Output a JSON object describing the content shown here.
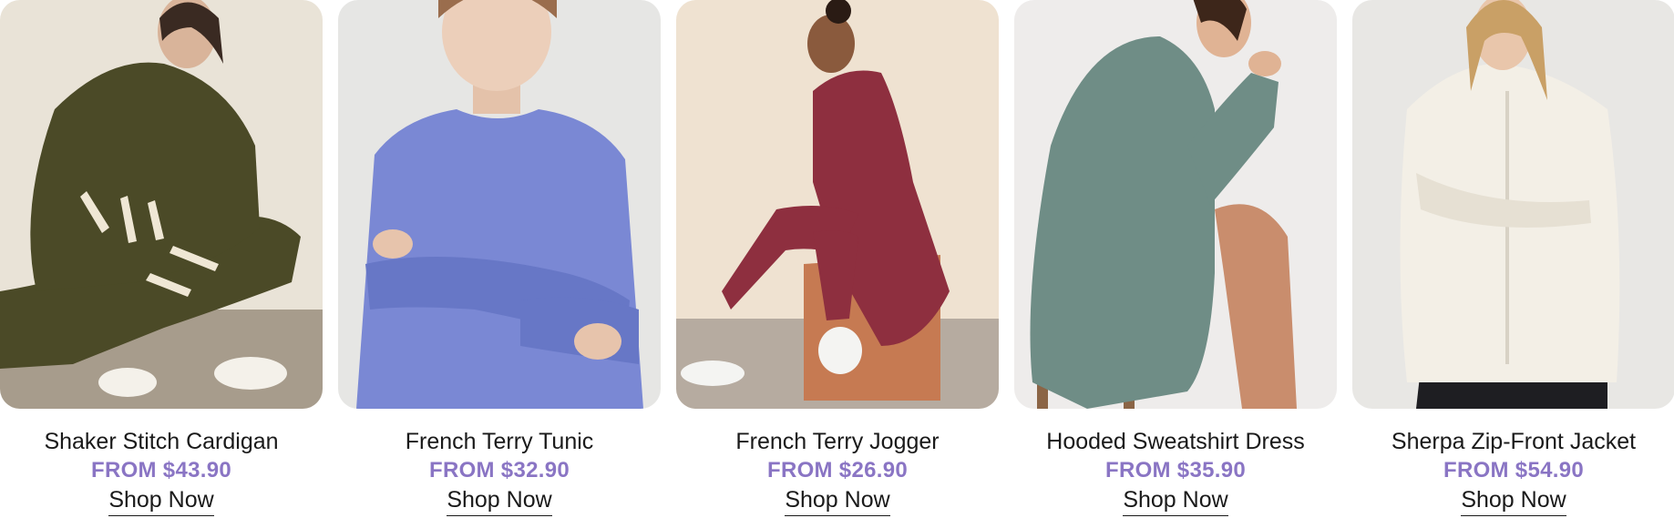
{
  "accent_color": "#8a75c4",
  "products": [
    {
      "name": "Shaker Stitch Cardigan",
      "price": "FROM $43.90",
      "cta": "Shop Now",
      "image_icon": "product-photo-olive-cardigan",
      "colors": {
        "bg": "#e9e3d7",
        "floor": "#a79c8c",
        "garment": "#4b4a27",
        "accent": "#efe7d5"
      }
    },
    {
      "name": "French Terry Tunic",
      "price": "FROM $32.90",
      "cta": "Shop Now",
      "image_icon": "product-photo-blue-tunic",
      "colors": {
        "bg": "#e6e6e4",
        "floor": "#dcdcd9",
        "garment": "#7a88d4",
        "accent": "#6777c6"
      }
    },
    {
      "name": "French Terry Jogger",
      "price": "FROM $26.90",
      "cta": "Shop Now",
      "image_icon": "product-photo-red-jogger",
      "colors": {
        "bg": "#efe2d1",
        "floor": "#b6aba0",
        "garment": "#8e2f3f",
        "accent": "#c67a52"
      }
    },
    {
      "name": "Hooded Sweatshirt Dress",
      "price": "FROM $35.90",
      "cta": "Shop Now",
      "image_icon": "product-photo-sage-dress",
      "colors": {
        "bg": "#eeeceb",
        "floor": "#e6e3e1",
        "garment": "#6f8d86",
        "accent": "#8b6546"
      }
    },
    {
      "name": "Sherpa Zip-Front Jacket",
      "price": "FROM $54.90",
      "cta": "Shop Now",
      "image_icon": "product-photo-cream-jacket",
      "colors": {
        "bg": "#e8e7e4",
        "floor": "#e2e0dc",
        "garment": "#f3efe6",
        "accent": "#1e1e22"
      }
    }
  ]
}
